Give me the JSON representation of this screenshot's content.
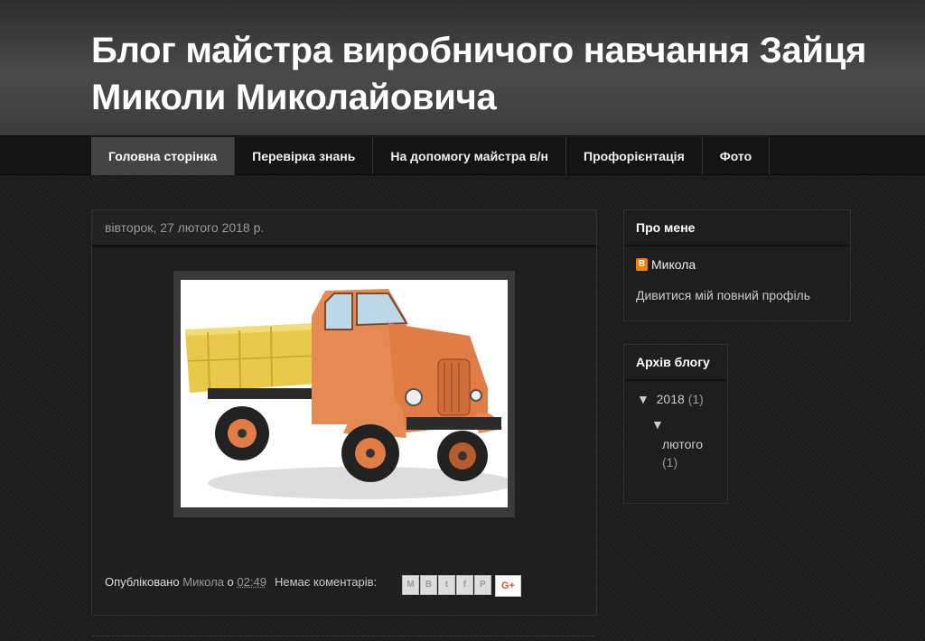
{
  "header": {
    "title": "Блог майстра виробничого навчання Зайця Миколи Миколайовича"
  },
  "tabs": [
    {
      "label": "Головна сторінка",
      "active": true
    },
    {
      "label": "Перевірка знань",
      "active": false
    },
    {
      "label": "На допомогу майстра в/н",
      "active": false
    },
    {
      "label": "Профорієнтація",
      "active": false
    },
    {
      "label": "Фото",
      "active": false
    }
  ],
  "post": {
    "date": "вівторок, 27 лютого 2018 р.",
    "published_label": "Опубліковано",
    "author": "Микола",
    "at_label": "о",
    "time": "02:49",
    "comments": "Немає коментарів:",
    "share_icons": [
      "email-icon",
      "blogthis-icon",
      "twitter-icon",
      "facebook-icon",
      "pinterest-icon"
    ],
    "gplus_label": "G+"
  },
  "sidebar": {
    "about": {
      "title": "Про мене",
      "name": "Микола",
      "profile_link": "Дивитися мій повний профіль"
    },
    "archive": {
      "title": "Архів блогу",
      "year": "2018",
      "year_count": "(1)",
      "month": "лютого",
      "month_count": "(1)"
    }
  },
  "colors": {
    "accent_blogger": "#f57d00",
    "background": "#1b1b1b",
    "tab_active": "#444444"
  }
}
